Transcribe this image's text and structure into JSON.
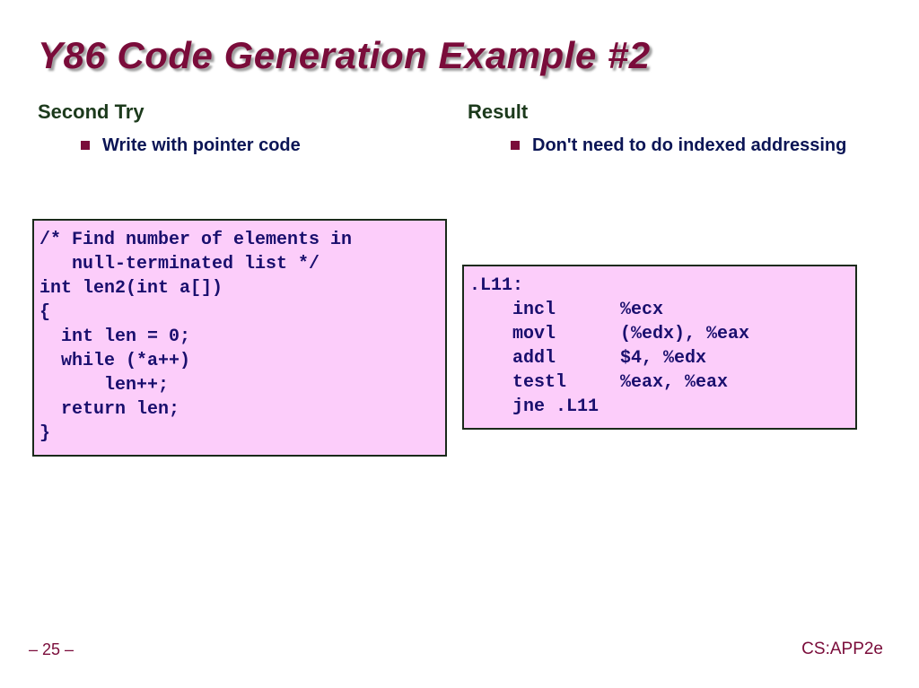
{
  "title": "Y86 Code Generation Example #2",
  "left": {
    "heading": "Second Try",
    "bullet": "Write with pointer code",
    "code": "/* Find number of elements in\n   null-terminated list */\nint len2(int a[])\n{\n  int len = 0;\n  while (*a++)\n      len++;\n  return len;\n}"
  },
  "right": {
    "heading": "Result",
    "bullet": "Don't need to do indexed addressing",
    "code": ".L11:\n    incl      %ecx\n    movl      (%edx), %eax\n    addl      $4, %edx\n    testl     %eax, %eax\n    jne .L11"
  },
  "footer": {
    "page": "– 25 –",
    "brand": "CS:APP2e"
  }
}
